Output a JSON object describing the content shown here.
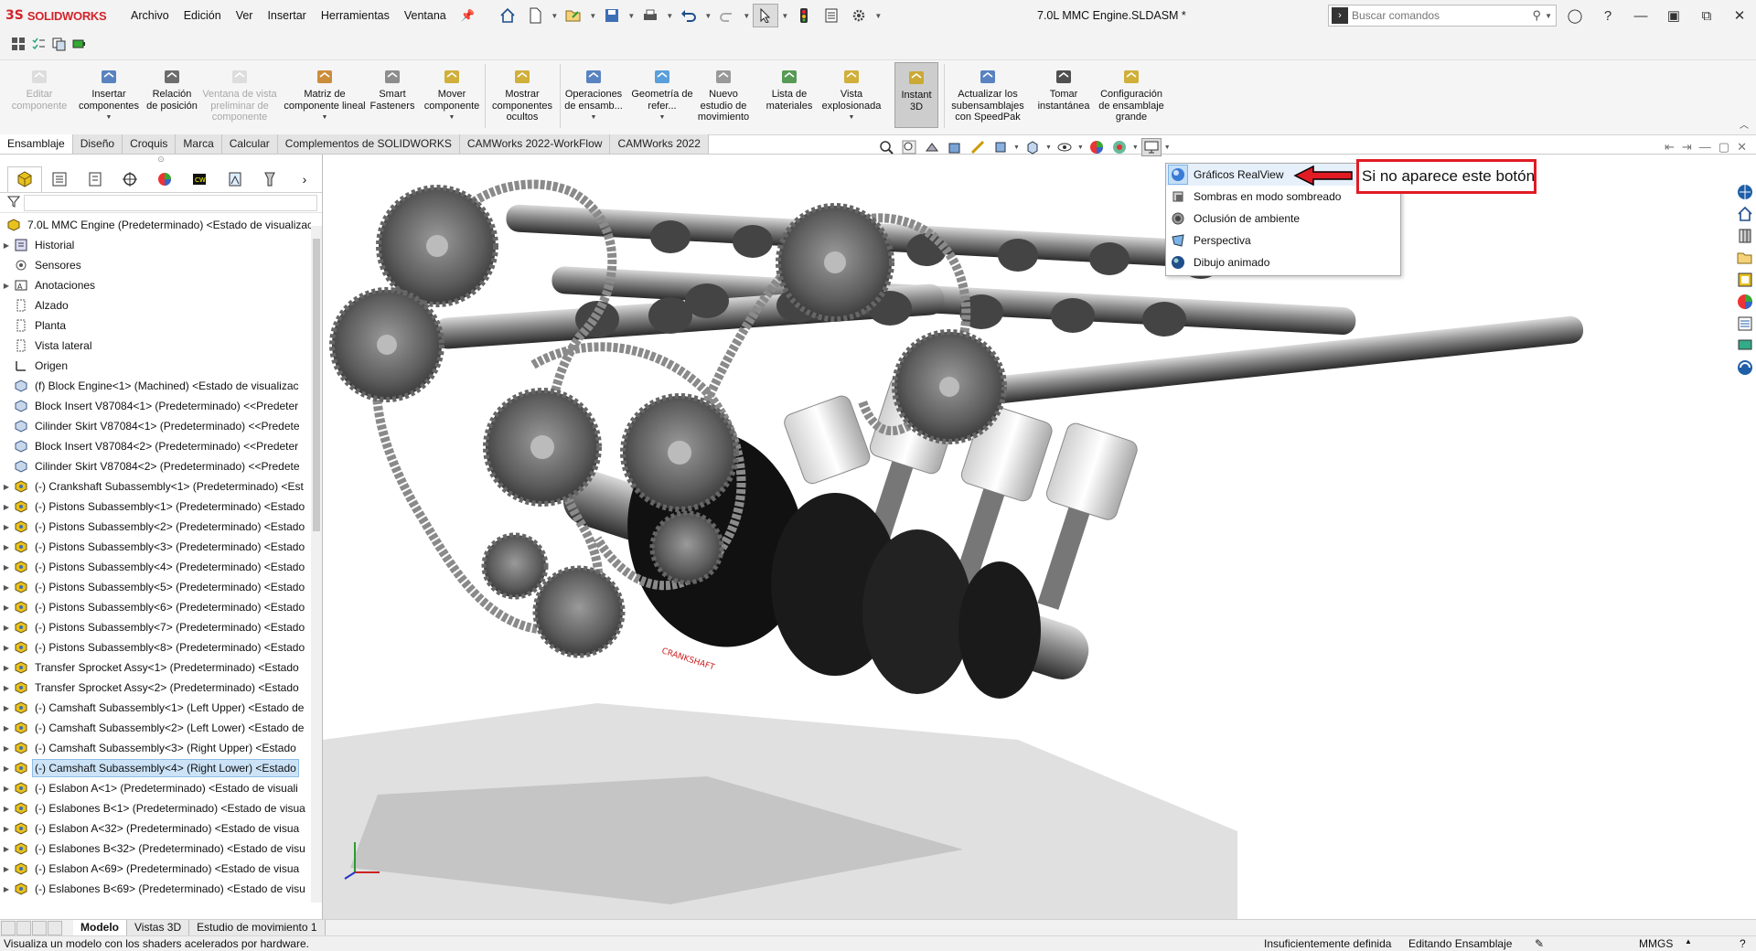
{
  "titlebar": {
    "logo": "SOLIDWORKS",
    "menus": [
      "Archivo",
      "Edición",
      "Ver",
      "Insertar",
      "Herramientas",
      "Ventana"
    ],
    "doc_title": "7.0L MMC Engine.SLDASM *",
    "search_placeholder": "Buscar comandos"
  },
  "ribbon": {
    "items": [
      {
        "label": "Editar componente",
        "disabled": true
      },
      {
        "label": "Insertar componentes",
        "dropdown": true
      },
      {
        "label": "Relación de posición"
      },
      {
        "label": "Ventana de vista preliminar de componente",
        "disabled": true
      },
      {
        "label": "Matriz de componente lineal",
        "dropdown": true
      },
      {
        "label": "Smart Fasteners"
      },
      {
        "label": "Mover componente",
        "dropdown": true
      },
      {
        "label": "Mostrar componentes ocultos"
      },
      {
        "label": "Operaciones de ensamb...",
        "dropdown": true
      },
      {
        "label": "Geometría de refer...",
        "dropdown": true
      },
      {
        "label": "Nuevo estudio de movimiento"
      },
      {
        "label": "Lista de materiales"
      },
      {
        "label": "Vista explosionada",
        "dropdown": true
      },
      {
        "label": "Instant 3D",
        "active": true
      },
      {
        "label": "Actualizar los subensamblajes con SpeedPak"
      },
      {
        "label": "Tomar instantánea"
      },
      {
        "label": "Configuración de ensamblaje grande"
      }
    ]
  },
  "tabs": [
    "Ensamblaje",
    "Diseño",
    "Croquis",
    "Marca",
    "Calcular",
    "Complementos de SOLIDWORKS",
    "CAMWorks 2022-WorkFlow",
    "CAMWorks 2022"
  ],
  "active_tab": "Ensamblaje",
  "tree": {
    "root": "7.0L MMC Engine  (Predeterminado) <Estado de visualizaci",
    "items": [
      {
        "label": "Historial",
        "icon": "history-icon",
        "exp": true
      },
      {
        "label": "Sensores",
        "icon": "sensor-icon",
        "exp": false
      },
      {
        "label": "Anotaciones",
        "icon": "annotations-icon",
        "exp": true
      },
      {
        "label": "Alzado",
        "icon": "plane-icon",
        "exp": false
      },
      {
        "label": "Planta",
        "icon": "plane-icon",
        "exp": false
      },
      {
        "label": "Vista lateral",
        "icon": "plane-icon",
        "exp": false
      },
      {
        "label": "Origen",
        "icon": "origin-icon",
        "exp": false
      },
      {
        "label": "(f) Block Engine<1> (Machined) <Estado de visualizac",
        "icon": "part-icon",
        "exp": false
      },
      {
        "label": "Block Insert V87084<1> (Predeterminado) <<Predeter",
        "icon": "part-icon",
        "exp": false
      },
      {
        "label": "Cilinder Skirt V87084<1> (Predeterminado) <<Predete",
        "icon": "part-icon",
        "exp": false
      },
      {
        "label": "Block Insert V87084<2> (Predeterminado) <<Predeter",
        "icon": "part-icon",
        "exp": false
      },
      {
        "label": "Cilinder Skirt V87084<2> (Predeterminado) <<Predete",
        "icon": "part-icon",
        "exp": false
      },
      {
        "label": "(-) Crankshaft Subassembly<1> (Predeterminado) <Est",
        "icon": "assembly-icon",
        "exp": true
      },
      {
        "label": "(-) Pistons Subassembly<1> (Predeterminado) <Estado",
        "icon": "assembly-icon",
        "exp": true
      },
      {
        "label": "(-) Pistons Subassembly<2> (Predeterminado) <Estado",
        "icon": "assembly-icon",
        "exp": true
      },
      {
        "label": "(-) Pistons Subassembly<3> (Predeterminado) <Estado",
        "icon": "assembly-icon",
        "exp": true
      },
      {
        "label": "(-) Pistons Subassembly<4> (Predeterminado) <Estado",
        "icon": "assembly-icon",
        "exp": true
      },
      {
        "label": "(-) Pistons Subassembly<5> (Predeterminado) <Estado",
        "icon": "assembly-icon",
        "exp": true
      },
      {
        "label": "(-) Pistons Subassembly<6> (Predeterminado) <Estado",
        "icon": "assembly-icon",
        "exp": true
      },
      {
        "label": "(-) Pistons Subassembly<7> (Predeterminado) <Estado",
        "icon": "assembly-icon",
        "exp": true
      },
      {
        "label": "(-) Pistons Subassembly<8> (Predeterminado) <Estado",
        "icon": "assembly-icon",
        "exp": true
      },
      {
        "label": "Transfer Sprocket Assy<1> (Predeterminado) <Estado",
        "icon": "assembly-icon",
        "exp": true
      },
      {
        "label": "Transfer Sprocket Assy<2> (Predeterminado) <Estado",
        "icon": "assembly-icon",
        "exp": true
      },
      {
        "label": "(-) Camshaft Subassembly<1> (Left Upper) <Estado de",
        "icon": "assembly-icon",
        "exp": true
      },
      {
        "label": "(-) Camshaft Subassembly<2> (Left Lower) <Estado de",
        "icon": "assembly-icon",
        "exp": true
      },
      {
        "label": "(-) Camshaft Subassembly<3> (Right Upper) <Estado",
        "icon": "assembly-icon",
        "exp": true
      },
      {
        "label": "(-) Camshaft Subassembly<4> (Right Lower) <Estado",
        "icon": "assembly-icon",
        "exp": true,
        "selected": true
      },
      {
        "label": "(-) Eslabon A<1> (Predeterminado) <Estado de visuali",
        "icon": "assembly-icon",
        "exp": true
      },
      {
        "label": "(-) Eslabones B<1> (Predeterminado) <Estado de visua",
        "icon": "assembly-icon",
        "exp": true
      },
      {
        "label": "(-) Eslabon A<32> (Predeterminado) <Estado de visua",
        "icon": "assembly-icon",
        "exp": true
      },
      {
        "label": "(-) Eslabones B<32> (Predeterminado) <Estado de visu",
        "icon": "assembly-icon",
        "exp": true
      },
      {
        "label": "(-) Eslabon A<69> (Predeterminado) <Estado de visua",
        "icon": "assembly-icon",
        "exp": true
      },
      {
        "label": "(-) Eslabones B<69> (Predeterminado) <Estado de visu",
        "icon": "assembly-icon",
        "exp": true
      }
    ]
  },
  "dropdown": {
    "items": [
      {
        "label": "Gráficos RealView",
        "icon": "realview-icon",
        "highlight": true
      },
      {
        "label": "Sombras en modo sombreado",
        "icon": "shadows-icon"
      },
      {
        "label": "Oclusión de ambiente",
        "icon": "ambient-occlusion-icon"
      },
      {
        "label": "Perspectiva",
        "icon": "perspective-icon"
      },
      {
        "label": "Dibujo animado",
        "icon": "cartoon-icon"
      }
    ]
  },
  "callout": "Si no aparece este botón",
  "bottom_tabs": [
    "Modelo",
    "Vistas 3D",
    "Estudio de movimiento 1"
  ],
  "active_bottom_tab": "Modelo",
  "status": {
    "message": "Visualiza un modelo con los shaders acelerados por hardware.",
    "definition": "Insuficientemente definida",
    "mode": "Editando Ensamblaje",
    "units": "MMGS"
  },
  "colors": {
    "accent": "#d2232a",
    "callout_border": "#e01b24",
    "selection": "#cce3f7",
    "assembly_icon": "#e8c21c"
  }
}
